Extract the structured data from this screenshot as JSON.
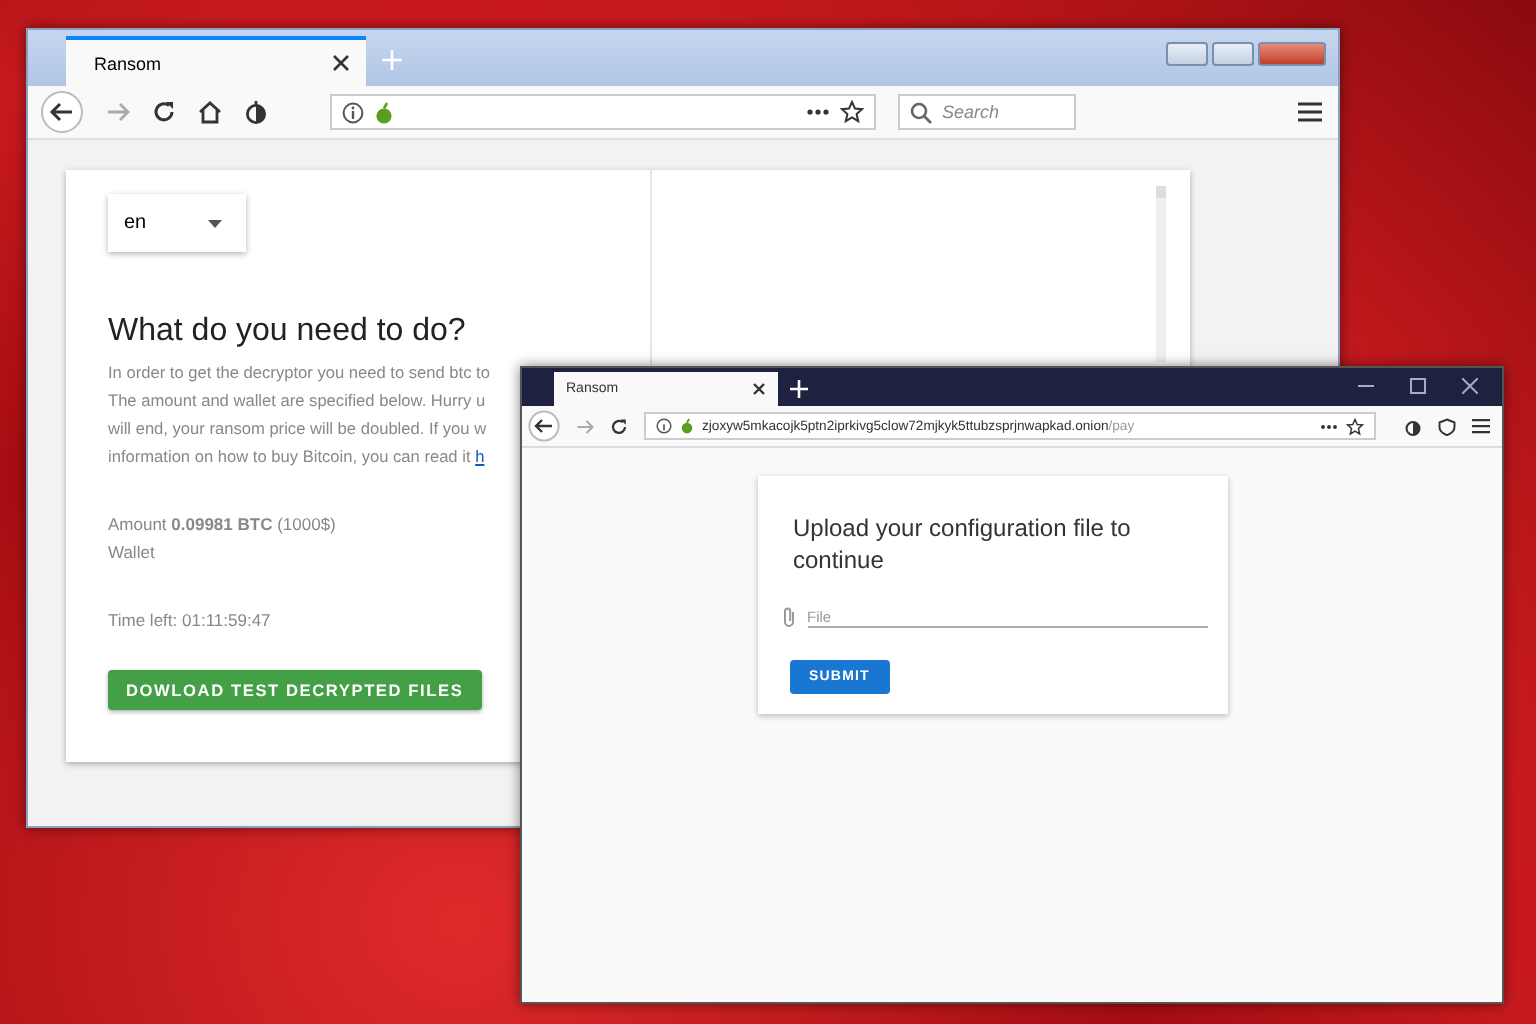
{
  "back_window": {
    "tab": {
      "title": "Ransom"
    },
    "search": {
      "placeholder": "Search"
    },
    "page": {
      "language_select": {
        "value": "en"
      },
      "heading": "What do you need to do?",
      "instruction_lines": [
        "In order to get the decryptor you need to send btc to",
        "The amount and wallet are specified below. Hurry u",
        "will end, your ransom price will be doubled. If you w",
        "information on how to buy Bitcoin, you can read it"
      ],
      "link": "h",
      "amount": "Amount **0.09981 BTC** (1000$)",
      "wallet": "Wallet",
      "time_left": "Time left: 01:11:59:47",
      "download_button": "DOWLOAD TEST DECRYPTED FILES"
    }
  },
  "front_window": {
    "tab": {
      "title": "Ransom"
    },
    "address_bar": {
      "url": "zjoxyw5mkacojk5ptn2iprkivg5clow72mjkyk5ttubzsprjnwapkad.onion",
      "path": "/pay"
    },
    "page": {
      "heading": "Upload your configuration file to continue",
      "file_field": {
        "placeholder": "File"
      },
      "submit_button": "SUBMIT"
    }
  }
}
